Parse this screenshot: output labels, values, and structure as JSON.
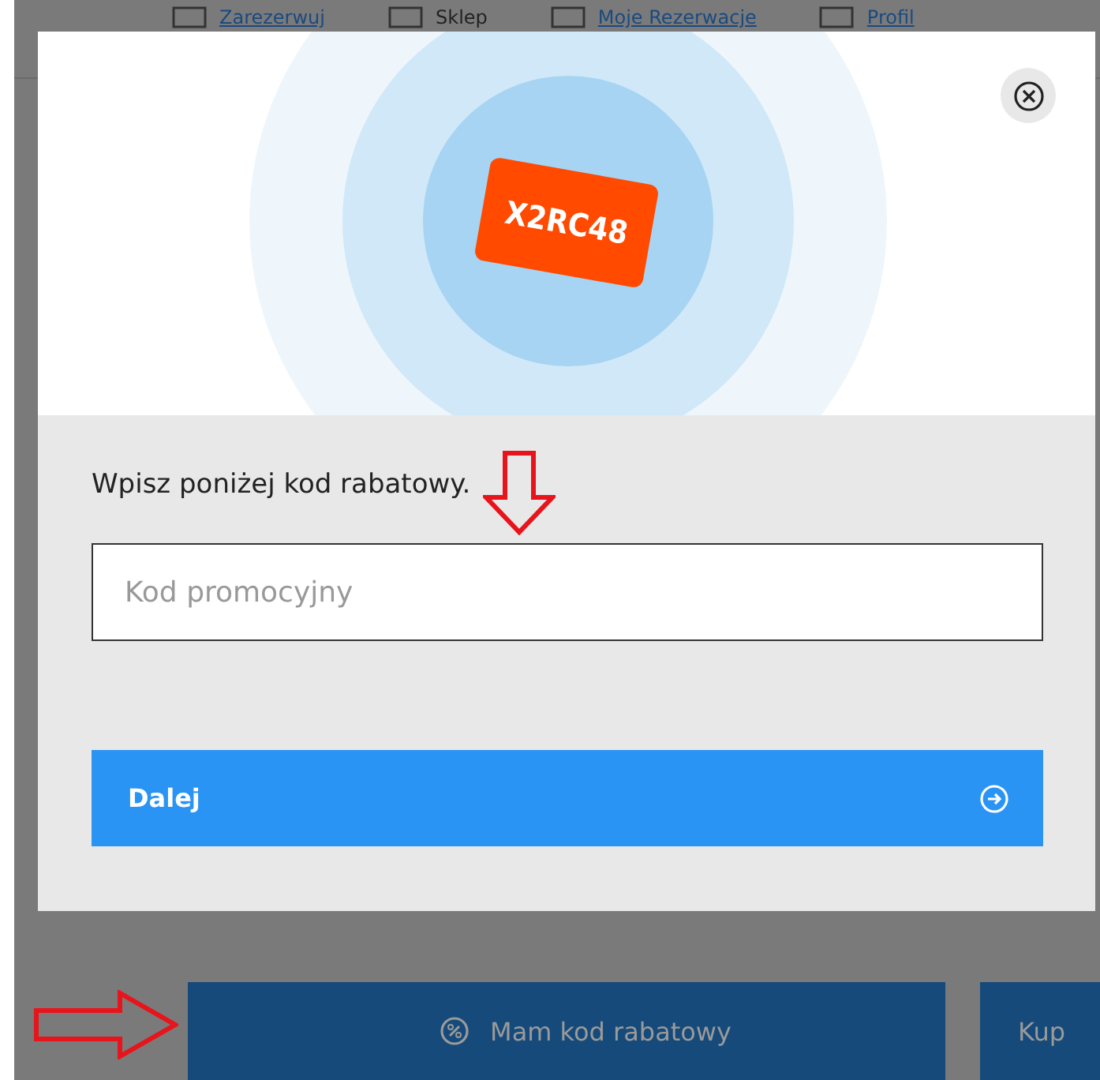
{
  "nav": [
    {
      "label": "Zarezerwuj",
      "kind": "link"
    },
    {
      "label": "Sklep",
      "kind": "plain"
    },
    {
      "label": "Moje Rezerwacje",
      "kind": "link"
    },
    {
      "label": "Profil",
      "kind": "link"
    }
  ],
  "modal": {
    "coupon_code": "X2RC48",
    "prompt": "Wpisz poniżej kod rabatowy.",
    "code_field": {
      "placeholder": "Kod promocyjny"
    },
    "submit": "Dalej"
  },
  "footer_buttons": [
    {
      "label": "Mam kod rabatowy",
      "kind": "discount"
    },
    {
      "label": "Kup",
      "kind": "buy"
    }
  ]
}
